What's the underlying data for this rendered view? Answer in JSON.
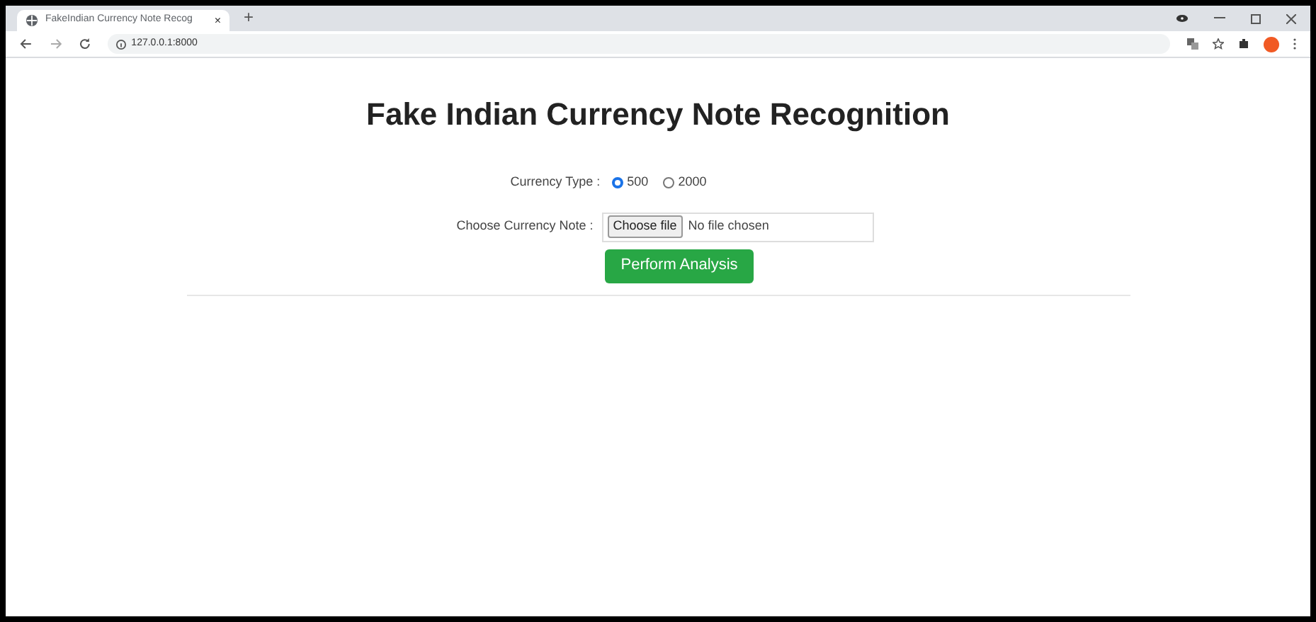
{
  "browser": {
    "tab": {
      "title": "FakeIndian Currency Note Recog",
      "close": "×"
    },
    "new_tab": "+",
    "address": "127.0.0.1:8000"
  },
  "page": {
    "title": "Fake Indian Currency Note Recognition",
    "currency_type": {
      "label": "Currency Type :",
      "options": [
        {
          "label": "500",
          "selected": true
        },
        {
          "label": "2000",
          "selected": false
        }
      ]
    },
    "file": {
      "label": "Choose Currency Note :",
      "button": "Choose file",
      "status": "No file chosen"
    },
    "submit": "Perform Analysis"
  }
}
